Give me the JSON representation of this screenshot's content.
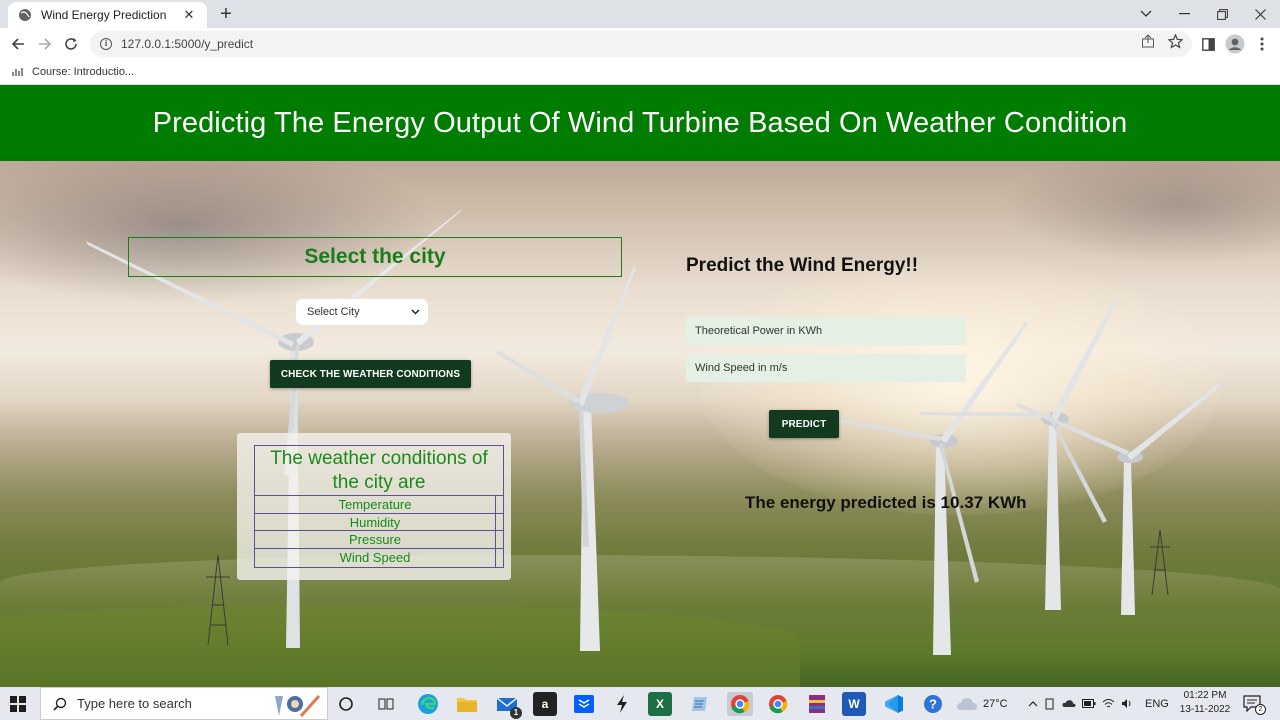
{
  "browser": {
    "tab_title": "Wind Energy Prediction",
    "url": "127.0.0.1:5000/y_predict",
    "bookmark": "Course: Introductio..."
  },
  "page": {
    "header": "Predictig The Energy Output Of Wind Turbine Based On Weather Condition",
    "city_heading": "Select the city",
    "city_select": "Select City",
    "weather_button": "CHECK THE WEATHER CONDITIONS",
    "weather_table": {
      "title": "The weather conditions of the city are",
      "rows": [
        "Temperature",
        "Humidity",
        "Pressure",
        "Wind Speed"
      ]
    },
    "predict_heading": "Predict the Wind Energy!!",
    "power_placeholder": "Theoretical Power in KWh",
    "wind_placeholder": "Wind Speed in m/s",
    "predict_button": "PREDICT",
    "result": "The energy predicted is 10.37 KWh"
  },
  "taskbar": {
    "search_placeholder": "Type here to search",
    "weather": "27°C",
    "language": "ENG",
    "time": "01:22 PM",
    "date": "13-11-2022",
    "mail_badge": "1",
    "notif_count": "2"
  },
  "colors": {
    "header_green": "#007d00",
    "heading_green": "#1a7d1a",
    "button_dark": "#123a1e",
    "field_bg": "#e3f0e3"
  }
}
